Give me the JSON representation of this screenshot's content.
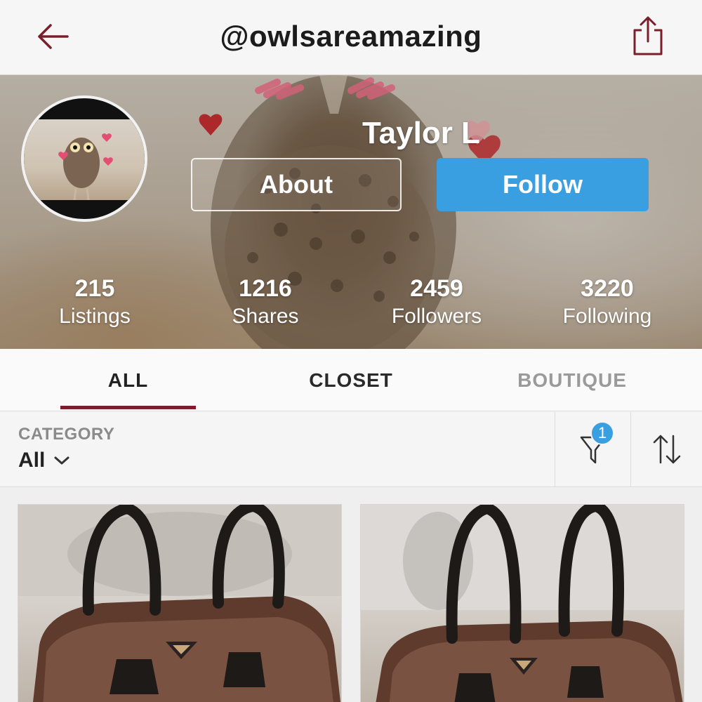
{
  "header": {
    "username": "@owlsareamazing",
    "back_icon": "arrow-left-icon",
    "share_icon": "share-icon",
    "accent_color": "#7b1e2b"
  },
  "profile": {
    "name": "Taylor L",
    "about_label": "About",
    "follow_label": "Follow",
    "follow_color": "#3a9fe0",
    "stats": [
      {
        "value": "215",
        "label": "Listings"
      },
      {
        "value": "1216",
        "label": "Shares"
      },
      {
        "value": "2459",
        "label": "Followers"
      },
      {
        "value": "3220",
        "label": "Following"
      }
    ]
  },
  "tabs": [
    {
      "label": "ALL",
      "active": true
    },
    {
      "label": "CLOSET",
      "active": false
    },
    {
      "label": "BOUTIQUE",
      "active": false
    }
  ],
  "filters": {
    "category_label": "CATEGORY",
    "category_value": "All",
    "filter_badge": "1",
    "filter_icon": "filter-funnel-icon",
    "sort_icon": "sort-arrows-icon"
  },
  "listings": [
    {
      "image": "brown-nylon-handbag-photo"
    },
    {
      "image": "brown-nylon-handbag-photo"
    }
  ]
}
